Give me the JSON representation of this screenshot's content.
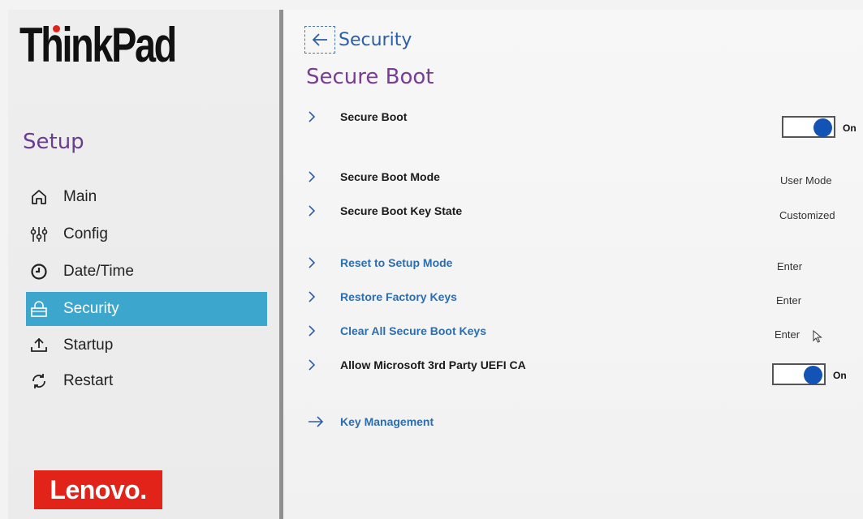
{
  "sidebar": {
    "brand": "ThinkPad",
    "title": "Setup",
    "items": [
      {
        "label": "Main",
        "icon": "home-icon"
      },
      {
        "label": "Config",
        "icon": "sliders-icon"
      },
      {
        "label": "Date/Time",
        "icon": "clock-icon"
      },
      {
        "label": "Security",
        "icon": "lock-icon",
        "active": true
      },
      {
        "label": "Startup",
        "icon": "upload-icon"
      },
      {
        "label": "Restart",
        "icon": "restart-icon"
      }
    ],
    "vendor_logo": "Lenovo."
  },
  "main": {
    "back_label": "Security",
    "page_title": "Secure Boot",
    "rows": {
      "secure_boot": {
        "label": "Secure Boot",
        "toggle_text": "On",
        "toggle_on": true
      },
      "secure_boot_mode": {
        "label": "Secure Boot Mode",
        "value": "User Mode"
      },
      "secure_boot_key_state": {
        "label": "Secure Boot Key State",
        "value": "Customized"
      },
      "reset_to_setup_mode": {
        "label": "Reset to Setup Mode",
        "value": "Enter"
      },
      "restore_factory_keys": {
        "label": "Restore Factory Keys",
        "value": "Enter"
      },
      "clear_all_secure_boot_keys": {
        "label": "Clear All Secure Boot Keys",
        "value": "Enter"
      },
      "allow_ms_3rd_party": {
        "label": "Allow Microsoft 3rd Party UEFI CA",
        "toggle_text": "On",
        "toggle_on": true
      },
      "key_management": {
        "label": "Key Management"
      }
    }
  },
  "colors": {
    "accent_purple": "#7a3d95",
    "link_blue": "#2c6db0",
    "active_nav": "#3ca6cc",
    "toggle_knob": "#1453b6",
    "lenovo_red": "#e2231a"
  }
}
